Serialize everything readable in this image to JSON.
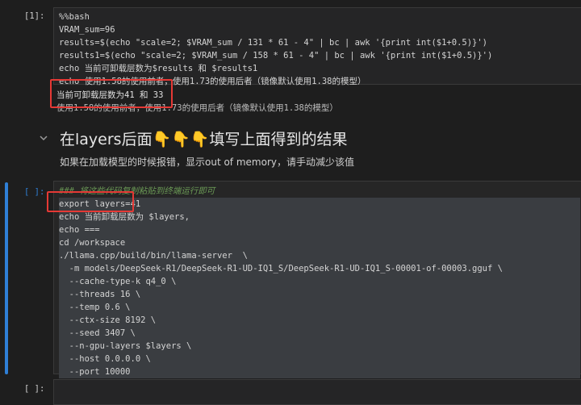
{
  "cell1": {
    "prompt": "[1]:",
    "lines": [
      "%%bash",
      "VRAM_sum=96",
      "results=$(echo \"scale=2; $VRAM_sum / 131 * 61 - 4\" | bc | awk '{print int($1+0.5)}')",
      "results1=$(echo \"scale=2; $VRAM_sum / 158 * 61 - 4\" | bc | awk '{print int($1+0.5)}')",
      "echo 当前可卸载层数为$results 和 $results1",
      "echo 使用1.58的使用前者，使用1.73的使用后者（镜像默认使用1.38的模型）"
    ]
  },
  "output1": {
    "lines": [
      "当前可卸载层数为41 和 33",
      "使用1.58的使用前者，使用1.73的使用后者（镜像默认使用1.38的模型）"
    ]
  },
  "markdown": {
    "heading": "在layers后面👇👇👇填写上面得到的结果",
    "text": "如果在加载模型的时候报错，显示out of memory，请手动减少该值"
  },
  "cell2": {
    "prompt": "[ ]:",
    "lines": [
      "### 将这些代码复制粘贴到终端运行即可",
      "export layers=41",
      "echo 当前卸载层数为 $layers,",
      "echo ===",
      "cd /workspace",
      "./llama.cpp/build/bin/llama-server  \\",
      "  -m models/DeepSeek-R1/DeepSeek-R1-UD-IQ1_S/DeepSeek-R1-UD-IQ1_S-00001-of-00003.gguf \\",
      "  --cache-type-k q4_0 \\",
      "  --threads 16 \\",
      "  --temp 0.6 \\",
      "  --ctx-size 8192 \\",
      "  --seed 3407 \\",
      "  --n-gpu-layers $layers \\",
      "  --host 0.0.0.0 \\",
      "  --port 10000"
    ]
  },
  "cell3": {
    "prompt": "[ ]:"
  },
  "colors": {
    "accent": "#2f7fd6",
    "highlight_box": "#e53935"
  }
}
